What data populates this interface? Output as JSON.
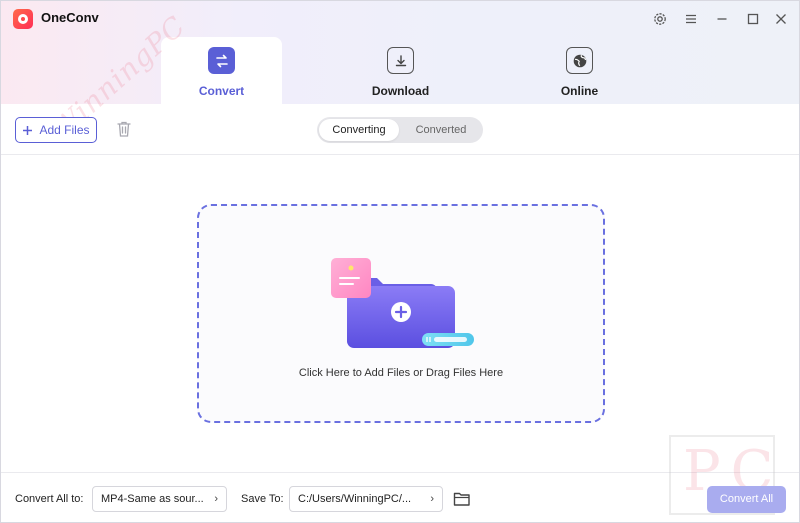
{
  "app": {
    "title": "OneConv"
  },
  "tabs": [
    {
      "label": "Convert",
      "icon": "convert-arrows-icon"
    },
    {
      "label": "Download",
      "icon": "download-icon"
    },
    {
      "label": "Online",
      "icon": "globe-icon"
    }
  ],
  "toolbar": {
    "add_files_label": "Add Files"
  },
  "segmented": {
    "converting": "Converting",
    "converted": "Converted"
  },
  "dropzone": {
    "text": "Click Here to Add Files or Drag Files Here"
  },
  "footer": {
    "convert_all_to_label": "Convert All to:",
    "format_value": "MP4-Same as sour...",
    "save_to_label": "Save To:",
    "path_value": "C:/Users/WinningPC/...",
    "convert_all_button": "Convert All"
  },
  "watermark": {
    "text": "WinningPC",
    "corner": "PC"
  },
  "colors": {
    "accent": "#5a5fd6",
    "convert_all_bg": "#a9acef",
    "logo": "#ff3b4f"
  }
}
